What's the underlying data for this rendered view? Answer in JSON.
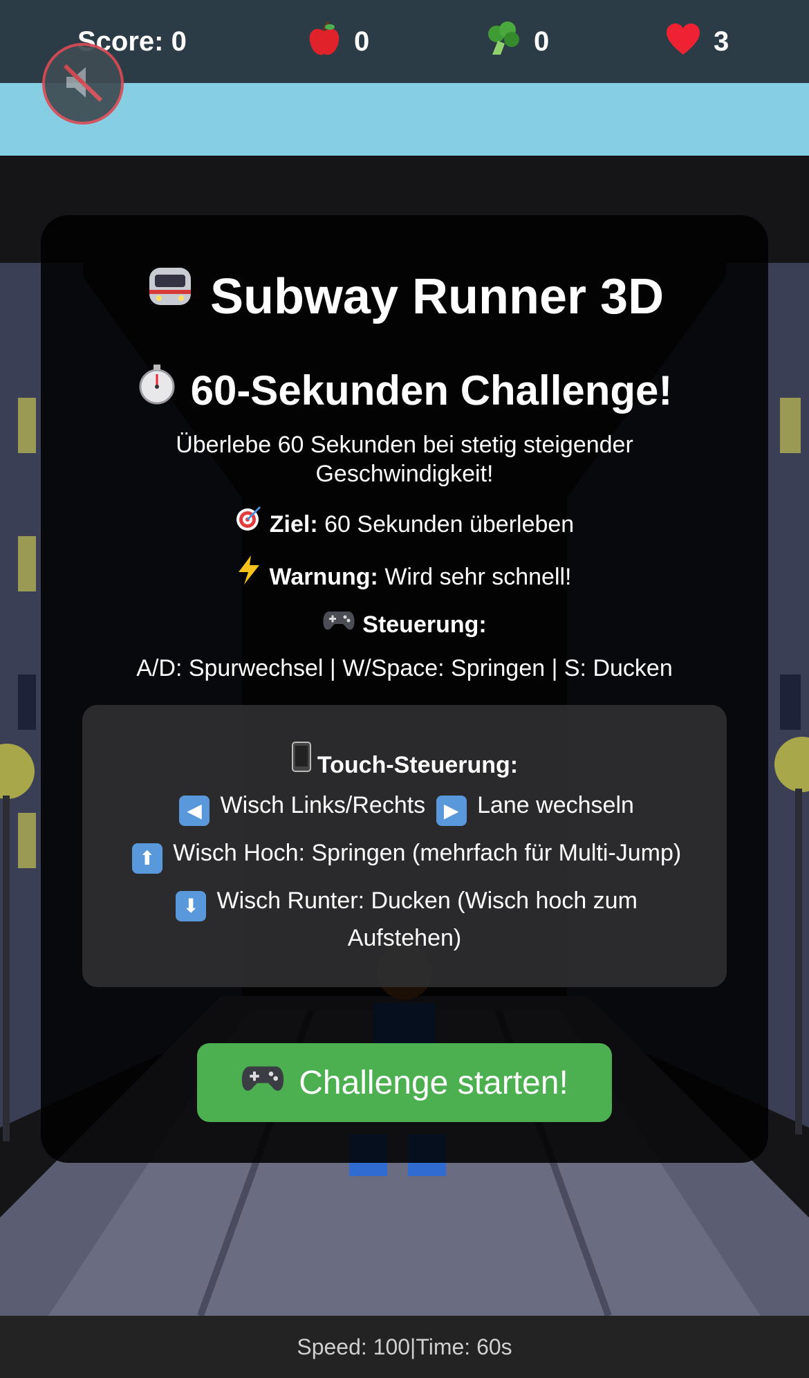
{
  "hud": {
    "score_label": "Score:",
    "score_value": "0",
    "apples_icon": "apple-icon",
    "apples_value": "0",
    "broccoli_icon": "broccoli-icon",
    "broccoli_value": "0",
    "lives_icon": "heart-icon",
    "lives_value": "3"
  },
  "mute_button": {
    "icon": "speaker-muted-icon",
    "state": "muted"
  },
  "modal": {
    "title_emoji": "🚇",
    "title": "Subway Runner 3D",
    "challenge_emoji": "⏱",
    "challenge_title": "60-Sekunden Challenge!",
    "description": "Überlebe 60 Sekunden bei stetig steigender Geschwindigkeit!",
    "goal_emoji": "🎯",
    "goal_label": "Ziel:",
    "goal_text": "60 Sekunden überleben",
    "warning_emoji": "⚡",
    "warning_label": "Warnung:",
    "warning_text": "Wird sehr schnell!",
    "controls_emoji": "🎮",
    "controls_label": "Steuerung:",
    "controls_text": "A/D: Spurwechsel | W/Space: Springen | S: Ducken",
    "touch": {
      "emoji": "📱",
      "title": "Touch-Steuerung:",
      "lr_left_arrow": "◀",
      "lr_text_1": "Wisch Links/Rechts",
      "lr_right_arrow": "▶",
      "lr_text_2": "Lane wechseln",
      "up_arrow": "⬆",
      "up_text": "Wisch Hoch: Springen (mehrfach für Multi-Jump)",
      "down_arrow": "⬇",
      "down_text": "Wisch Runter: Ducken (Wisch hoch zum Aufstehen)"
    },
    "start_emoji": "🎮",
    "start_label": "Challenge starten!"
  },
  "status_bar": {
    "text": "Speed: 100|Time: 60s"
  },
  "colors": {
    "hud_bg": "#2b3c46",
    "sky": "#86cfe3",
    "start_button": "#4caf50",
    "mute_ring": "#d94b55"
  }
}
